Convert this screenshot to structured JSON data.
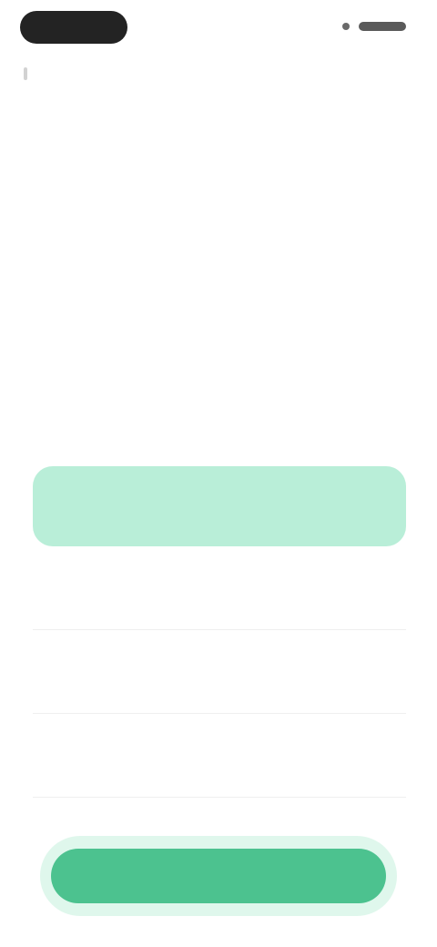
{
  "header": {
    "brand_icon": "brand-logo-icon",
    "status_icon": "account-icon"
  },
  "question": {
    "text": ""
  },
  "options": [
    {
      "label": "",
      "selected": true
    },
    {
      "label": "",
      "selected": false
    },
    {
      "label": "",
      "selected": false
    },
    {
      "label": "",
      "selected": false
    }
  ],
  "continue": {
    "label": ""
  },
  "colors": {
    "selected_bg": "#b9eed8",
    "accent": "#4cc28f",
    "text": "#1e1e1e"
  }
}
